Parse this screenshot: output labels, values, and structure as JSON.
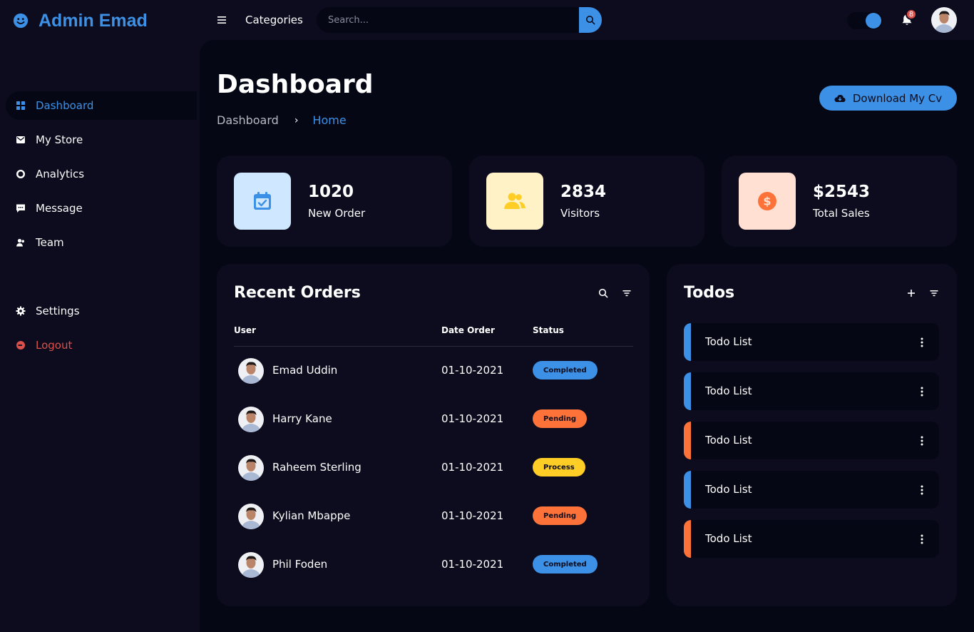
{
  "brand": {
    "name": "Admin Emad",
    "icon": "smile-icon"
  },
  "topbar": {
    "menu_icon": "menu-icon",
    "nav_link": "Categories",
    "search_placeholder": "Search...",
    "search_icon": "search-icon",
    "notification_count": "8",
    "notification_icon": "bell-icon"
  },
  "sidebar": {
    "items": [
      {
        "label": "Dashboard",
        "icon": "dashboard-icon",
        "active": true
      },
      {
        "label": "My Store",
        "icon": "store-icon"
      },
      {
        "label": "Analytics",
        "icon": "analytics-icon"
      },
      {
        "label": "Message",
        "icon": "message-icon"
      },
      {
        "label": "Team",
        "icon": "team-icon"
      }
    ],
    "bottom": [
      {
        "label": "Settings",
        "icon": "gear-icon"
      },
      {
        "label": "Logout",
        "icon": "logout-icon"
      }
    ]
  },
  "main": {
    "title": "Dashboard",
    "breadcrumb": [
      "Dashboard",
      "Home"
    ],
    "download_label": "Download My Cv",
    "stats": [
      {
        "value": "1020",
        "label": "New Order",
        "icon": "calendar-check-icon",
        "bg": "#cfe8ff",
        "fg": "#3c91e6"
      },
      {
        "value": "2834",
        "label": "Visitors",
        "icon": "group-icon",
        "bg": "#fff2c6",
        "fg": "#ffce26"
      },
      {
        "value": "$2543",
        "label": "Total Sales",
        "icon": "dollar-icon",
        "bg": "#ffe0d3",
        "fg": "#fd7238"
      }
    ],
    "orders": {
      "title": "Recent Orders",
      "columns": [
        "User",
        "Date Order",
        "Status"
      ],
      "rows": [
        {
          "user": "Emad Uddin",
          "date": "01-10-2021",
          "status": "Completed",
          "color": "#3c91e6"
        },
        {
          "user": "Harry Kane",
          "date": "01-10-2021",
          "status": "Pending",
          "color": "#fd7238"
        },
        {
          "user": "Raheem Sterling",
          "date": "01-10-2021",
          "status": "Process",
          "color": "#ffce26"
        },
        {
          "user": "Kylian Mbappe",
          "date": "01-10-2021",
          "status": "Pending",
          "color": "#fd7238"
        },
        {
          "user": "Phil Foden",
          "date": "01-10-2021",
          "status": "Completed",
          "color": "#3c91e6"
        }
      ]
    },
    "todos": {
      "title": "Todos",
      "items": [
        {
          "label": "Todo List",
          "state": "completed"
        },
        {
          "label": "Todo List",
          "state": "completed"
        },
        {
          "label": "Todo List",
          "state": "not-completed"
        },
        {
          "label": "Todo List",
          "state": "completed"
        },
        {
          "label": "Todo List",
          "state": "not-completed"
        }
      ]
    }
  },
  "colors": {
    "accent": "#3c91e6",
    "background": "#060714",
    "panel": "#0c0c1e",
    "danger": "#db504a",
    "orange": "#fd7238",
    "yellow": "#ffce26"
  }
}
